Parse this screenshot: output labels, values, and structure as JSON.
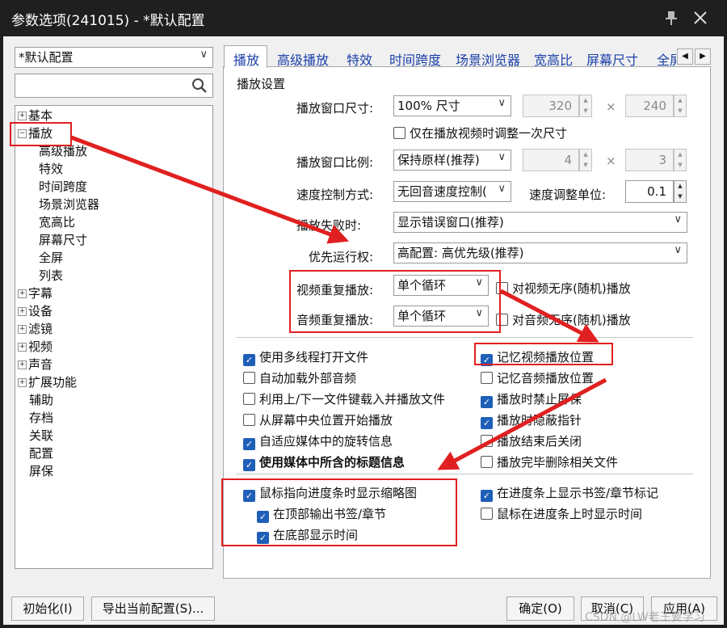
{
  "window": {
    "title": "参数选项(241015) - *默认配置"
  },
  "profile": {
    "selected": "*默认配置"
  },
  "search": {
    "value": ""
  },
  "tree": {
    "items": [
      {
        "label": "基本",
        "expander": "+"
      },
      {
        "label": "播放",
        "expander": "−"
      },
      {
        "label": "高级播放"
      },
      {
        "label": "特效"
      },
      {
        "label": "时间跨度"
      },
      {
        "label": "场景浏览器"
      },
      {
        "label": "宽高比"
      },
      {
        "label": "屏幕尺寸"
      },
      {
        "label": "全屏"
      },
      {
        "label": "列表"
      },
      {
        "label": "字幕",
        "expander": "+"
      },
      {
        "label": "设备",
        "expander": "+"
      },
      {
        "label": "滤镜",
        "expander": "+"
      },
      {
        "label": "视频",
        "expander": "+"
      },
      {
        "label": "声音",
        "expander": "+"
      },
      {
        "label": "扩展功能",
        "expander": "+"
      },
      {
        "label": "辅助"
      },
      {
        "label": "存档"
      },
      {
        "label": "关联"
      },
      {
        "label": "配置"
      },
      {
        "label": "屏保"
      }
    ]
  },
  "tabs": [
    "播放",
    "高级播放",
    "特效",
    "时间跨度",
    "场景浏览器",
    "宽高比",
    "屏幕尺寸",
    "全屏"
  ],
  "group": {
    "title": "播放设置"
  },
  "settings": {
    "window_size": {
      "label": "播放窗口尺寸:",
      "value": "100% 尺寸",
      "width": "320",
      "height": "240",
      "x": "×"
    },
    "resize_once": {
      "label": "仅在播放视频时调整一次尺寸",
      "checked": false
    },
    "aspect": {
      "label": "播放窗口比例:",
      "value": "保持原样(推荐)",
      "a": "4",
      "b": "3",
      "x": "×"
    },
    "speed": {
      "label": "速度控制方式:",
      "value": "无回音速度控制(",
      "unit_label": "速度调整单位:",
      "unit_value": "0.1"
    },
    "fail": {
      "label": "播放失败时:",
      "value": "显示错误窗口(推荐)"
    },
    "priority": {
      "label": "优先运行权:",
      "value": "高配置: 高优先级(推荐)"
    },
    "video_repeat": {
      "label": "视频重复播放:",
      "value": "单个循环",
      "random": "对视频无序(随机)播放"
    },
    "audio_repeat": {
      "label": "音频重复播放:",
      "value": "单个循环",
      "random": "对音频无序(随机)播放"
    }
  },
  "options_left": [
    {
      "label": "使用多线程打开文件",
      "checked": true,
      "bold": false
    },
    {
      "label": "自动加载外部音频",
      "checked": false,
      "bold": false
    },
    {
      "label": "利用上/下一文件键载入并播放文件",
      "checked": false,
      "bold": false
    },
    {
      "label": "从屏幕中央位置开始播放",
      "checked": false,
      "bold": false
    },
    {
      "label": "自适应媒体中的旋转信息",
      "checked": true,
      "bold": false
    },
    {
      "label": "使用媒体中所含的标题信息",
      "checked": true,
      "bold": true
    }
  ],
  "options_right": [
    {
      "label": "记忆视频播放位置",
      "checked": true
    },
    {
      "label": "记忆音频播放位置",
      "checked": false
    },
    {
      "label": "播放时禁止屏保",
      "checked": true
    },
    {
      "label": "播放时隐蔽指针",
      "checked": true
    },
    {
      "label": "播放结束后关闭",
      "checked": false
    },
    {
      "label": "播放完毕删除相关文件",
      "checked": false
    }
  ],
  "thumb": {
    "main": {
      "label": "鼠标指向进度条时显示缩略图",
      "checked": true
    },
    "sub1": {
      "label": "在顶部输出书签/章节",
      "checked": true
    },
    "sub2": {
      "label": "在底部显示时间",
      "checked": true
    },
    "bookmark": {
      "label": "在进度条上显示书签/章节标记",
      "checked": true
    },
    "hover_time": {
      "label": "鼠标在进度条上时显示时间",
      "checked": false
    }
  },
  "buttons": {
    "init": "初始化(I)",
    "export": "导出当前配置(S)...",
    "ok": "确定(O)",
    "cancel": "取消(C)",
    "apply": "应用(A)"
  },
  "icons": {
    "pin": "pin-icon",
    "close": "close-icon",
    "search": "search-icon"
  },
  "watermark": "CSDN @LW老王要学习",
  "colors": {
    "annotation": "#e02020",
    "check": "#1f5fb8",
    "tab_text": "#1b3fa8"
  }
}
